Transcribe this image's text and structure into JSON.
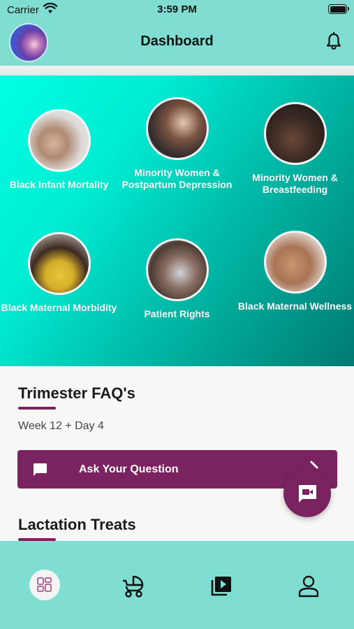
{
  "status_bar": {
    "carrier": "Carrier",
    "time": "3:59 PM"
  },
  "header": {
    "title": "Dashboard"
  },
  "topics": [
    {
      "label": "Black Infant Mortality"
    },
    {
      "label": "Minority Women & Postpartum Depression"
    },
    {
      "label": "Minority Women & Breastfeeding"
    },
    {
      "label": "Black Maternal Morbidity"
    },
    {
      "label": "Patient Rights"
    },
    {
      "label": "Black Maternal Wellness"
    }
  ],
  "trimester": {
    "title": "Trimester FAQ's",
    "week": "Week 12 + Day 4",
    "ask_label": "Ask Your Question"
  },
  "lactation": {
    "title": "Lactation Treats"
  },
  "colors": {
    "brand": "#7b2360",
    "teal": "#7fded1",
    "accent": "#00ecd3"
  },
  "icons": {
    "nav": [
      "dashboard-icon",
      "stroller-icon",
      "video-library-icon",
      "profile-icon"
    ],
    "header": [
      "bell-icon"
    ],
    "fab": "video-chat-icon"
  }
}
